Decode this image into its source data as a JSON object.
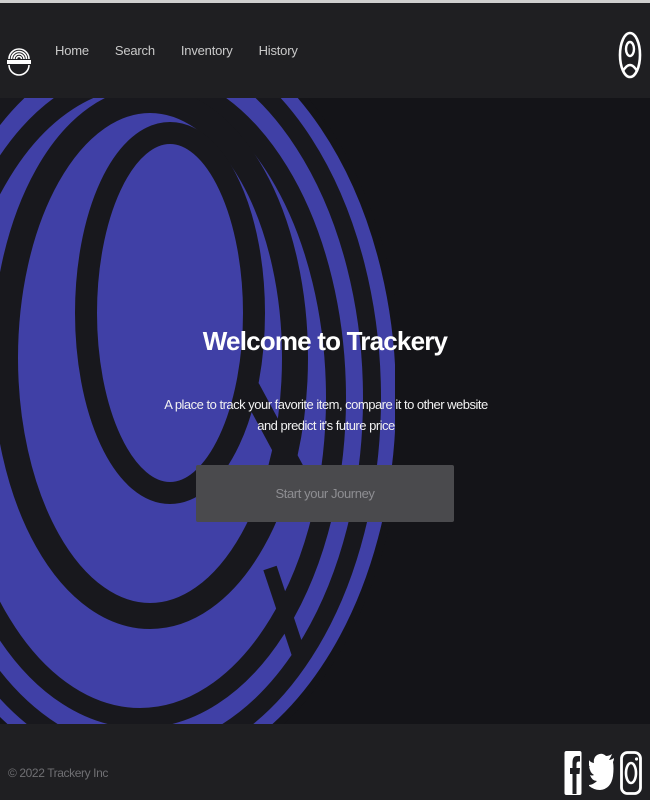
{
  "header": {
    "logo_icon": "trackery-logo-icon",
    "nav": [
      {
        "label": "Home"
      },
      {
        "label": "Search"
      },
      {
        "label": "Inventory"
      },
      {
        "label": "History"
      }
    ],
    "profile_icon": "user-circle-icon"
  },
  "hero": {
    "title": "Welcome to Trackery",
    "subtitle": "A place to track your favorite item, compare it to other website and predict it's future price",
    "cta_label": "Start your Journey",
    "accent_color": "#4040a6"
  },
  "footer": {
    "copyright": "© 2022 Trackery Inc",
    "social": [
      {
        "icon": "facebook-icon"
      },
      {
        "icon": "twitter-icon"
      },
      {
        "icon": "instagram-icon"
      }
    ]
  }
}
